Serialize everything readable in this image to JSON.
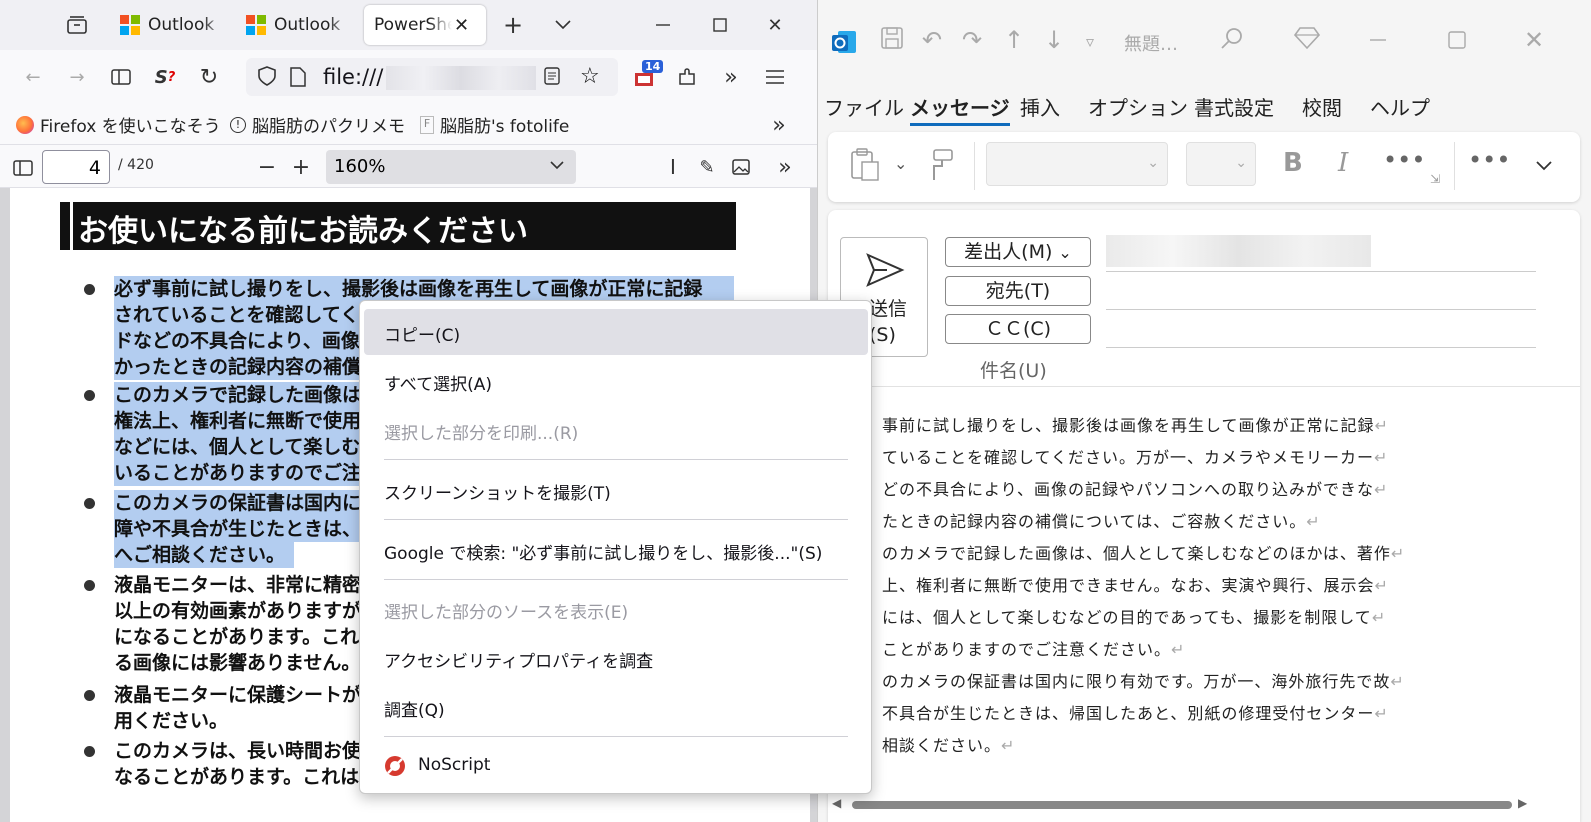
{
  "firefox": {
    "tabs": [
      {
        "label": "Outlook"
      },
      {
        "label": "Outlook"
      },
      {
        "label": "PowerShell"
      }
    ],
    "url_prefix": "file:///",
    "extension_badge": "14",
    "bookmarks": [
      {
        "label": "Firefox を使いこなそう"
      },
      {
        "label": "脳脂肪のパクリメモ"
      },
      {
        "label": "脳脂肪's fotolife"
      }
    ],
    "pdf": {
      "page": "4",
      "page_count": "/ 420",
      "zoom": "160%",
      "heading": "お使いになる前にお読みください",
      "bullets": [
        {
          "lines": [
            "必ず事前に試し撮りをし、撮影後は画像を再生して画像が正常に記録",
            "されていることを確認してく",
            "ドなどの不具合により、画像",
            "かったときの記録内容の補償"
          ]
        },
        {
          "lines": [
            "このカメラで記録した画像は",
            "権法上、権利者に無断で使用",
            "などには、個人として楽しむ",
            "いることがありますのでご注"
          ]
        },
        {
          "lines": [
            "このカメラの保証書は国内に",
            "障や不具合が生じたときは、",
            "へご相談ください。"
          ]
        },
        {
          "lines": [
            "液晶モニターは、非常に精密",
            "以上の有効画素がありますが",
            "になることがあります。これ",
            "る画像には影響ありません。"
          ]
        },
        {
          "lines": [
            "液晶モニターに保護シートが",
            "用ください。"
          ]
        },
        {
          "lines": [
            "このカメラは、長い時間お使",
            "なることがあります。これは"
          ]
        }
      ]
    }
  },
  "context_menu": {
    "items": [
      {
        "label": "コピー(C)",
        "state": "highlighted"
      },
      {
        "label": "すべて選択(A)",
        "state": "normal"
      },
      {
        "label": "選択した部分を印刷...(R)",
        "state": "disabled"
      },
      {
        "label": "スクリーンショットを撮影(T)",
        "state": "normal"
      },
      {
        "label": "Google で検索: \"必ず事前に試し撮りをし、撮影後...\"(S)",
        "state": "normal"
      },
      {
        "label": "選択した部分のソースを表示(E)",
        "state": "disabled"
      },
      {
        "label": "アクセシビリティプロパティを調査",
        "state": "normal"
      },
      {
        "label": "調査(Q)",
        "state": "normal"
      },
      {
        "label": "NoScript",
        "state": "normal"
      }
    ]
  },
  "outlook": {
    "title": "無題…",
    "tabs": [
      "ファイル",
      "メッセージ",
      "挿入",
      "オプション",
      "書式設定",
      "校閲",
      "ヘルプ"
    ],
    "active_tab": "メッセージ",
    "send_label_line1": "送信",
    "send_label_line2": "(S)",
    "from_button": "差出人(M)",
    "to_button": "宛先(T)",
    "cc_button": "ＣＣ(C)",
    "subject_label": "件名(U)",
    "body_lines": [
      "事前に試し撮りをし、撮影後は画像を再生して画像が正常に記録",
      "ていることを確認してください。万が一、カメラやメモリーカー",
      "どの不具合により、画像の記録やパソコンへの取り込みができな",
      "たときの記録内容の補償については、ご容赦ください。",
      "のカメラで記録した画像は、個人として楽しむなどのほかは、著作",
      "上、権利者に無断で使用できません。なお、実演や興行、展示会",
      "には、個人として楽しむなどの目的であっても、撮影を制限して",
      "ことがありますのでご注意ください。",
      "のカメラの保証書は国内に限り有効です。万が一、海外旅行先で故",
      "不具合が生じたときは、帰国したあと、別紙の修理受付センター",
      "相談ください。"
    ],
    "paragraph_mark": "↵"
  },
  "colors": {
    "selection": "#b3cdf0",
    "outlook_accent": "#0f6cbd",
    "menu_highlight": "#e0e0e6"
  }
}
